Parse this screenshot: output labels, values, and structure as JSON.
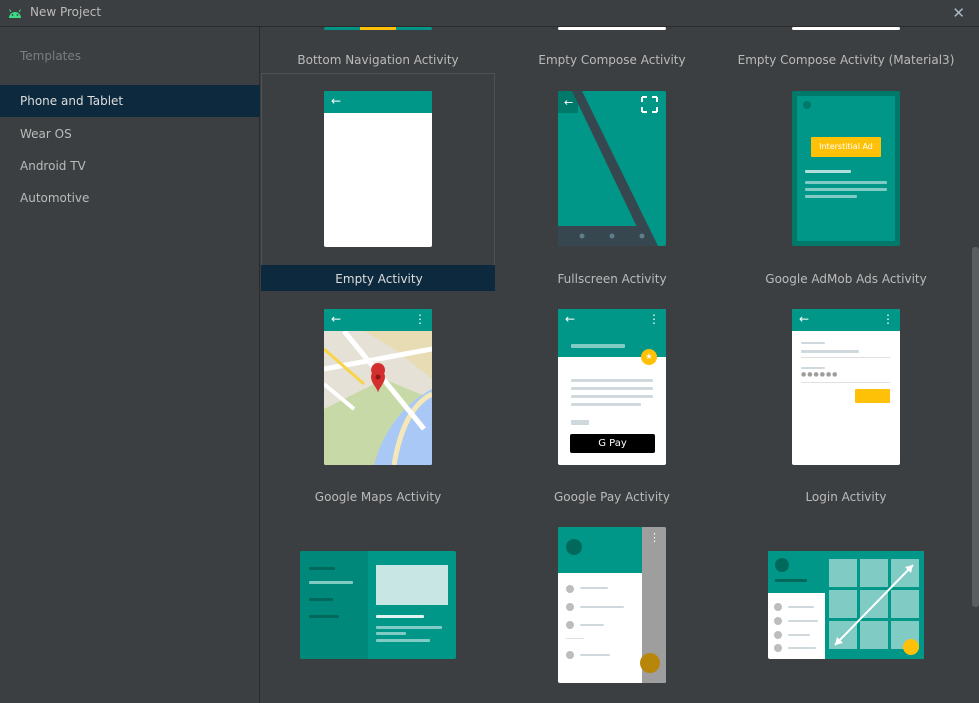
{
  "window": {
    "title": "New Project",
    "close_icon": "close-icon"
  },
  "sidebar": {
    "header": "Templates",
    "items": [
      {
        "label": "Phone and Tablet",
        "selected": true
      },
      {
        "label": "Wear OS"
      },
      {
        "label": "Android TV"
      },
      {
        "label": "Automotive"
      }
    ]
  },
  "templates": {
    "row0": [
      "Bottom Navigation Activity",
      "Empty Compose Activity",
      "Empty Compose Activity (Material3)"
    ],
    "row1": [
      "Empty Activity",
      "Fullscreen Activity",
      "Google AdMob Ads Activity"
    ],
    "row2": [
      "Google Maps Activity",
      "Google Pay Activity",
      "Login Activity"
    ],
    "admob_badge": "Interstitial Ad",
    "gpay_button": "G Pay",
    "selected": "Empty Activity"
  },
  "colors": {
    "teal": "#009688",
    "dark_teal": "#00796b",
    "selection": "#0d293e",
    "amber": "#ffc107"
  }
}
